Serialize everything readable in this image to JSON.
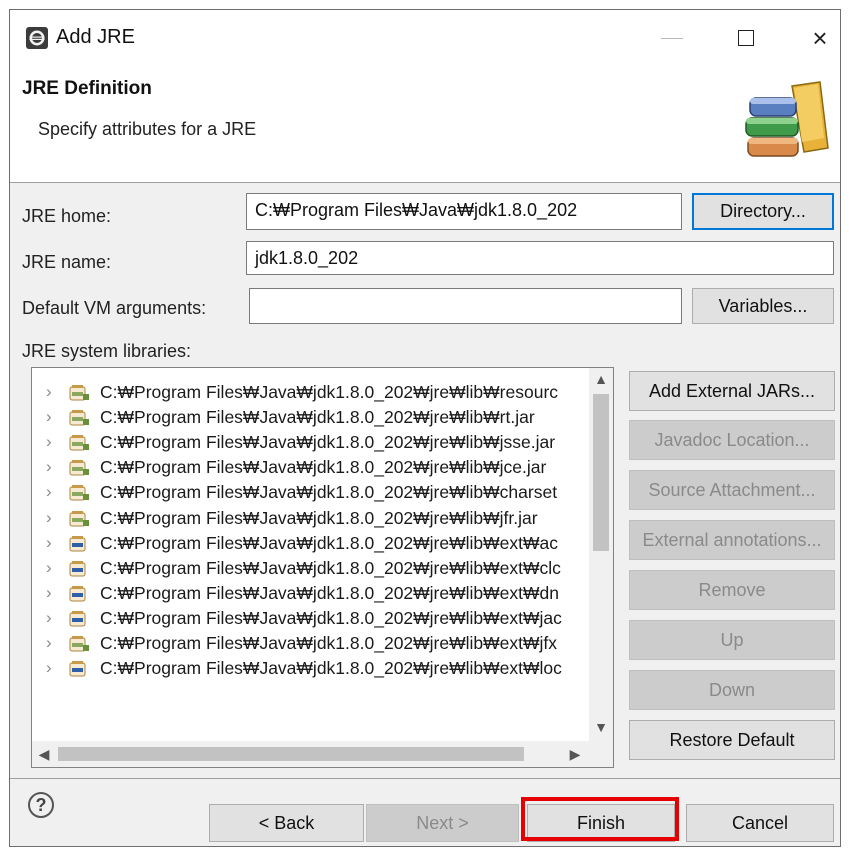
{
  "window": {
    "title": "Add JRE"
  },
  "titlebar": {
    "minimize": "—",
    "maximize": "□",
    "close": "×"
  },
  "header": {
    "title": "JRE Definition",
    "description": "Specify attributes for a JRE"
  },
  "form": {
    "jre_home_label": "JRE home:",
    "jre_home_value": "C:₩Program Files₩Java₩jdk1.8.0_202",
    "directory_button": "Directory...",
    "jre_name_label": "JRE name:",
    "jre_name_value": "jdk1.8.0_202",
    "vm_args_label": "Default VM arguments:",
    "vm_args_value": "",
    "variables_button": "Variables...",
    "libraries_label": "JRE system libraries:"
  },
  "libraries": [
    {
      "path": "C:₩Program Files₩Java₩jdk1.8.0_202₩jre₩lib₩resourc",
      "icon": "jar-source-icon"
    },
    {
      "path": "C:₩Program Files₩Java₩jdk1.8.0_202₩jre₩lib₩rt.jar",
      "icon": "jar-source-icon"
    },
    {
      "path": "C:₩Program Files₩Java₩jdk1.8.0_202₩jre₩lib₩jsse.jar",
      "icon": "jar-source-icon"
    },
    {
      "path": "C:₩Program Files₩Java₩jdk1.8.0_202₩jre₩lib₩jce.jar",
      "icon": "jar-source-icon"
    },
    {
      "path": "C:₩Program Files₩Java₩jdk1.8.0_202₩jre₩lib₩charset",
      "icon": "jar-source-icon"
    },
    {
      "path": "C:₩Program Files₩Java₩jdk1.8.0_202₩jre₩lib₩jfr.jar",
      "icon": "jar-source-icon"
    },
    {
      "path": "C:₩Program Files₩Java₩jdk1.8.0_202₩jre₩lib₩ext₩ac",
      "icon": "jar-icon"
    },
    {
      "path": "C:₩Program Files₩Java₩jdk1.8.0_202₩jre₩lib₩ext₩clc",
      "icon": "jar-icon"
    },
    {
      "path": "C:₩Program Files₩Java₩jdk1.8.0_202₩jre₩lib₩ext₩dn",
      "icon": "jar-icon"
    },
    {
      "path": "C:₩Program Files₩Java₩jdk1.8.0_202₩jre₩lib₩ext₩jac",
      "icon": "jar-icon"
    },
    {
      "path": "C:₩Program Files₩Java₩jdk1.8.0_202₩jre₩lib₩ext₩jfx",
      "icon": "jar-source-icon"
    },
    {
      "path": "C:₩Program Files₩Java₩jdk1.8.0_202₩jre₩lib₩ext₩loc",
      "icon": "jar-icon"
    }
  ],
  "side_buttons": {
    "add_external_jars": "Add External JARs...",
    "javadoc_location": "Javadoc Location...",
    "source_attachment": "Source Attachment...",
    "external_annotations": "External annotations...",
    "remove": "Remove",
    "up": "Up",
    "down": "Down",
    "restore_default": "Restore Default"
  },
  "footer": {
    "help": "?",
    "back": "< Back",
    "next": "Next >",
    "finish": "Finish",
    "cancel": "Cancel"
  },
  "colors": {
    "highlight": "#e60000",
    "default_button_border": "#0078d7"
  }
}
